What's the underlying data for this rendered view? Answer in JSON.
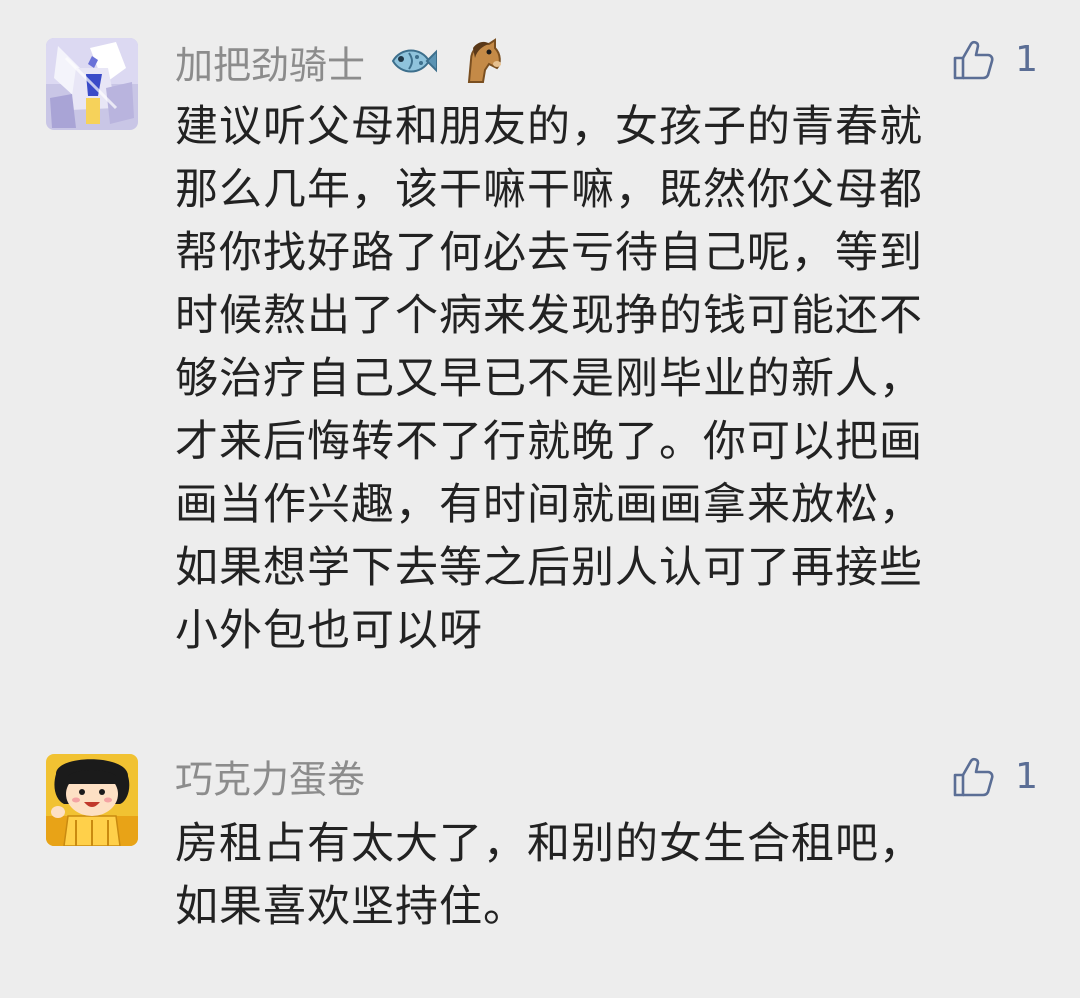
{
  "comments": [
    {
      "author": "加把劲骑士",
      "badges": [
        "fish-icon",
        "horse-icon"
      ],
      "likes": "1",
      "lines": [
        "建议听父母和朋友的，女孩子的青春就",
        "那么几年，该干嘛干嘛，既然你父母都",
        "帮你找好路了何必去亏待自己呢，等到",
        "时候熬出了个病来发现挣的钱可能还不",
        "够治疗自己又早已不是刚毕业的新人，",
        "才来后悔转不了行就晚了。你可以把画",
        "画当作兴趣，有时间就画画拿来放松，",
        "如果想学下去等之后别人认可了再接些",
        "小外包也可以呀"
      ]
    },
    {
      "author": "巧克力蛋卷",
      "badges": [],
      "likes": "1",
      "lines": [
        "房租占有太大了，和别的女生合租吧，",
        "如果喜欢坚持住。"
      ]
    }
  ],
  "colors": {
    "background": "#ededed",
    "author": "#8c8c8c",
    "text": "#222222",
    "like": "#5b6e95"
  }
}
